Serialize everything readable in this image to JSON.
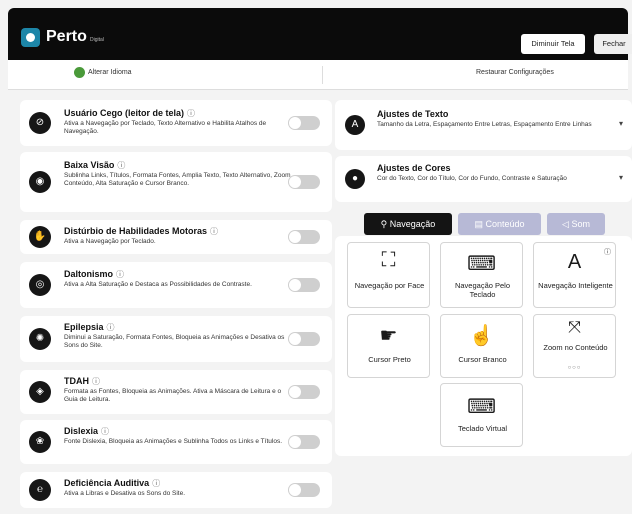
{
  "header": {
    "logo": "Perto",
    "logo_sub": "Digital",
    "shrink_button": "Diminuir Tela",
    "close_button": "Fechar"
  },
  "subbar": {
    "language": "Alterar Idioma",
    "restore": "Restaurar Configurações"
  },
  "profiles": [
    {
      "title": "Usuário Cego (leitor de tela)",
      "desc": "Ativa a Navegação por Teclado, Texto Alternativo e Habilita Atalhos de Navegação.",
      "icon": "eye-slash-icon"
    },
    {
      "title": "Baixa Visão",
      "desc": "Sublinha Links, Títulos, Formata Fontes, Amplia Texto, Texto Alternativo, Zoom Conteúdo, Alta Saturação e Cursor Branco.",
      "icon": "low-vision-icon"
    },
    {
      "title": "Distúrbio de Habilidades Motoras",
      "desc": "Ativa a Navegação por Teclado.",
      "icon": "hand-icon"
    },
    {
      "title": "Daltonismo",
      "desc": "Ativa a Alta Saturação e Destaca as Possibilidades de Contraste.",
      "icon": "eye-icon"
    },
    {
      "title": "Epilepsia",
      "desc": "Diminui a Saturação, Formata Fontes, Bloqueia as Animações e Desativa os Sons do Site.",
      "icon": "brain-icon"
    },
    {
      "title": "TDAH",
      "desc": "Formata as Fontes, Bloqueia as Animações. Ativa a Máscara de Leitura e o Guia de Leitura.",
      "icon": "focus-icon"
    },
    {
      "title": "Dislexia",
      "desc": "Fonte Dislexia, Bloqueia as Animações e Sublinha Todos os Links e Títulos.",
      "icon": "book-icon"
    },
    {
      "title": "Deficiência Auditiva",
      "desc": "Ativa a Libras e Desativa os Sons do Site.",
      "icon": "ear-icon"
    }
  ],
  "settings": [
    {
      "title": "Ajustes de Texto",
      "desc": "Tamanho da Letra, Espaçamento Entre Letras, Espaçamento Entre Linhas",
      "icon": "text-icon"
    },
    {
      "title": "Ajustes de Cores",
      "desc": "Cor do Texto, Cor do Título, Cor do Fundo, Contraste e Saturação",
      "icon": "drop-icon"
    }
  ],
  "tabs": {
    "nav": "Navegação",
    "content": "Conteúdo",
    "sound": "Som"
  },
  "tiles": {
    "face": "Navegação por Face",
    "keyboard": "Navegação Pelo Teclado",
    "smart": "Navegação Inteligente",
    "cursor_black": "Cursor Preto",
    "cursor_white": "Cursor Branco",
    "zoom": "Zoom no Conteúdo",
    "virtual_kb": "Teclado Virtual"
  }
}
